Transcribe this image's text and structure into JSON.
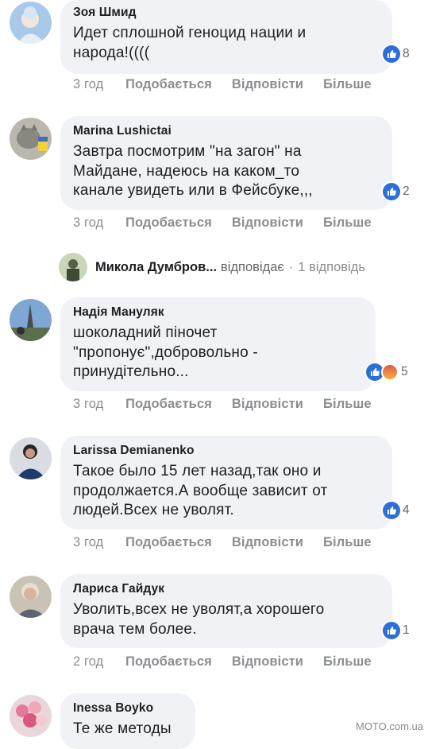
{
  "comments": [
    {
      "author": "Зоя Шмид",
      "text": [
        "Идет сплошной геноцид нации и",
        "народа!(((("
      ],
      "reactions": [
        "like"
      ],
      "reaction_count": "8",
      "time": "3 год",
      "like_label": "Подобається",
      "reply_label": "Відповісти",
      "more_label": "Більше"
    },
    {
      "author": "Marina Lushictai",
      "text": [
        "Завтра посмотрим \"на загон\" на",
        "Майдане, надеюсь на каком_то",
        "канале увидеть или в Фейсбуке,,,"
      ],
      "reactions": [
        "like"
      ],
      "reaction_count": "2",
      "time": "3 год",
      "like_label": "Подобається",
      "reply_label": "Відповісти",
      "more_label": "Більше"
    },
    {
      "author": "Надія Мануляк",
      "text": [
        "шоколадний піночет",
        "\"пропонує\",добровольно -",
        "принудітельно..."
      ],
      "reactions": [
        "like",
        "angry"
      ],
      "reaction_count": "5",
      "time": "3 год",
      "like_label": "Подобається",
      "reply_label": "Відповісти",
      "more_label": "Більше"
    },
    {
      "author": "Larissa Demianenko",
      "text": [
        "Такое было 15 лет назад,так оно и",
        "продолжается.А вообще зависит от",
        "людей.Всех не уволят."
      ],
      "reactions": [
        "like"
      ],
      "reaction_count": "4",
      "time": "3 год",
      "like_label": "Подобається",
      "reply_label": "Відповісти",
      "more_label": "Більше"
    },
    {
      "author": "Лариса Гайдук",
      "text": [
        "Уволить,всех не уволят,а хорошего",
        "врача тем более."
      ],
      "reactions": [
        "like"
      ],
      "reaction_count": "1",
      "time": "2 год",
      "like_label": "Подобається",
      "reply_label": "Відповісти",
      "more_label": "Більше"
    },
    {
      "author": "Inessa Boyko",
      "text": [
        "Те же методы"
      ]
    }
  ],
  "reply_summary": {
    "author": "Микола Думбров...",
    "verb": "відповідає",
    "separator": "·",
    "count_label": "1 відповідь"
  },
  "watermark": "MOTO.com.ua",
  "colors": {
    "bubble": "#f0f2f5",
    "like_blue": "#2d6fd9",
    "meta_gray": "#8a8d91"
  }
}
